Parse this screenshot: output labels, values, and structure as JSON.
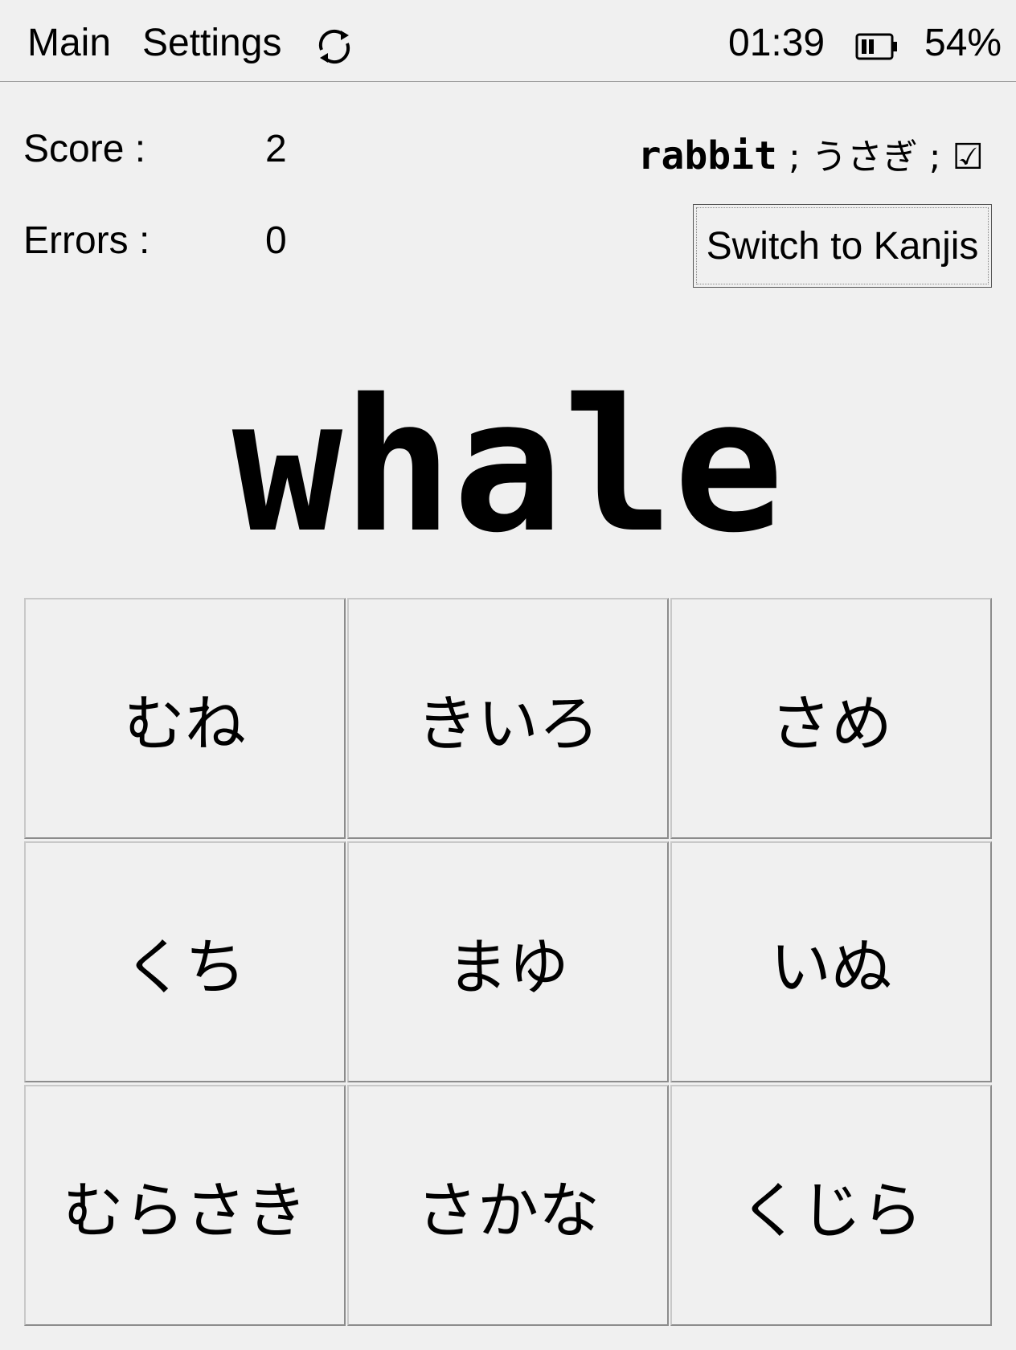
{
  "topbar": {
    "menu_main": "Main",
    "menu_settings": "Settings",
    "clock": "01:39",
    "battery": "54%",
    "icons": [
      "refresh-icon",
      "battery-icon"
    ]
  },
  "stats": {
    "score_label": "Score :",
    "score_value": "2",
    "errors_label": "Errors :",
    "errors_value": "0"
  },
  "previous": {
    "word": "rabbit",
    "rest": " ; うさぎ ; ☑"
  },
  "switch_label": "Switch to Kanjis",
  "question": "whale",
  "choices": [
    "むね",
    "きいろ",
    "さめ",
    "くち",
    "まゆ",
    "いぬ",
    "むらさき",
    "さかな",
    "くじら"
  ]
}
